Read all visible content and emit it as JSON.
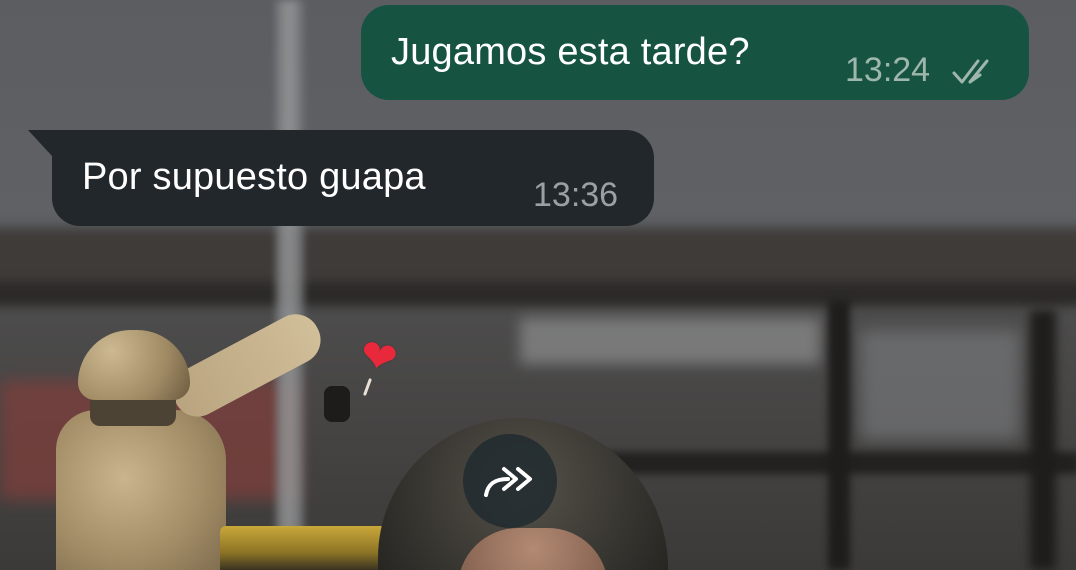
{
  "chat": {
    "messages": [
      {
        "direction": "outgoing",
        "text": "Jugamos esta tarde?",
        "time": "13:24",
        "status": "read",
        "status_icon": "double-check-icon"
      },
      {
        "direction": "incoming",
        "text": "Por supuesto guapa",
        "time": "13:36"
      }
    ]
  },
  "media": {
    "sticker_icon": "red-heart-emoji",
    "forward_icon": "forward-arrow-icon"
  },
  "colors": {
    "outgoing_bubble": "#165441",
    "incoming_bubble": "#22272b",
    "text": "#ffffff",
    "outgoing_time": "#9fb6ad",
    "incoming_time": "#9aa0a4",
    "heart": "#e8283b"
  }
}
